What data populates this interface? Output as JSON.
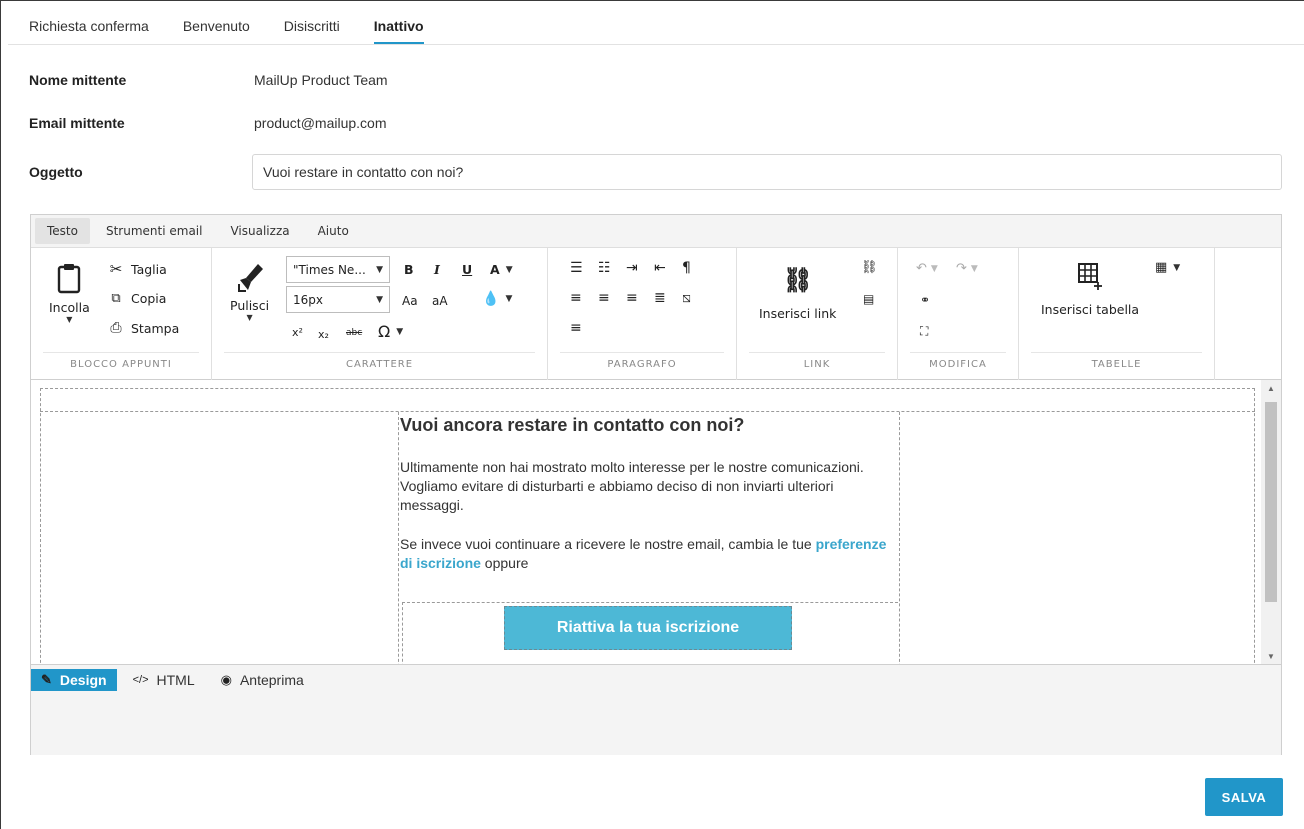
{
  "tabs": [
    {
      "label": "Richiesta conferma",
      "active": false
    },
    {
      "label": "Benvenuto",
      "active": false
    },
    {
      "label": "Disiscritti",
      "active": false
    },
    {
      "label": "Inattivo",
      "active": true
    }
  ],
  "form": {
    "sender_name_label": "Nome mittente",
    "sender_name_value": "MailUp Product Team",
    "sender_email_label": "Email mittente",
    "sender_email_value": "product@mailup.com",
    "subject_label": "Oggetto",
    "subject_value": "Vuoi restare in contatto con noi?"
  },
  "editor": {
    "menu": [
      "Testo",
      "Strumenti email",
      "Visualizza",
      "Aiuto"
    ],
    "clipboard": {
      "paste": "Incolla",
      "cut": "Taglia",
      "copy": "Copia",
      "print": "Stampa",
      "group": "BLOCCO APPUNTI"
    },
    "character": {
      "clean": "Pulisci",
      "font_family": "\"Times Ne...",
      "font_size": "16px",
      "bold": "B",
      "italic": "I",
      "underline": "U",
      "font_color": "A",
      "grow": "Aa",
      "shrink": "aA",
      "superscript": "x²",
      "subscript": "x₂",
      "strike": "abc",
      "omega": "Ω",
      "group": "CARATTERE"
    },
    "paragraph": {
      "group": "PARAGRAFO"
    },
    "link": {
      "insert": "Inserisci link",
      "group": "LINK"
    },
    "edit": {
      "group": "MODIFICA"
    },
    "tables": {
      "insert": "Inserisci tabella",
      "group": "TABELLE"
    },
    "modes": [
      {
        "label": "Design",
        "icon": "pencil-icon",
        "active": true
      },
      {
        "label": "HTML",
        "icon": "code-icon",
        "active": false
      },
      {
        "label": "Anteprima",
        "icon": "eye-icon",
        "active": false
      }
    ]
  },
  "email": {
    "heading": "Vuoi ancora restare in contatto con noi?",
    "para1": "Ultimamente non hai mostrato molto interesse per le nostre comunicazioni. Vogliamo evitare di disturbarti e abbiamo deciso di non inviarti ulteriori messaggi.",
    "para2_before": "Se invece vuoi continuare a ricevere le nostre email, cambia le tue ",
    "para2_link": "preferenze di iscrizione",
    "para2_after": " oppure",
    "cta": "Riattiva la tua iscrizione",
    "cta_color": "#4db8d6",
    "link_color": "#3aa6cc"
  },
  "save_label": "SALVA",
  "accent_color": "#2196c9"
}
